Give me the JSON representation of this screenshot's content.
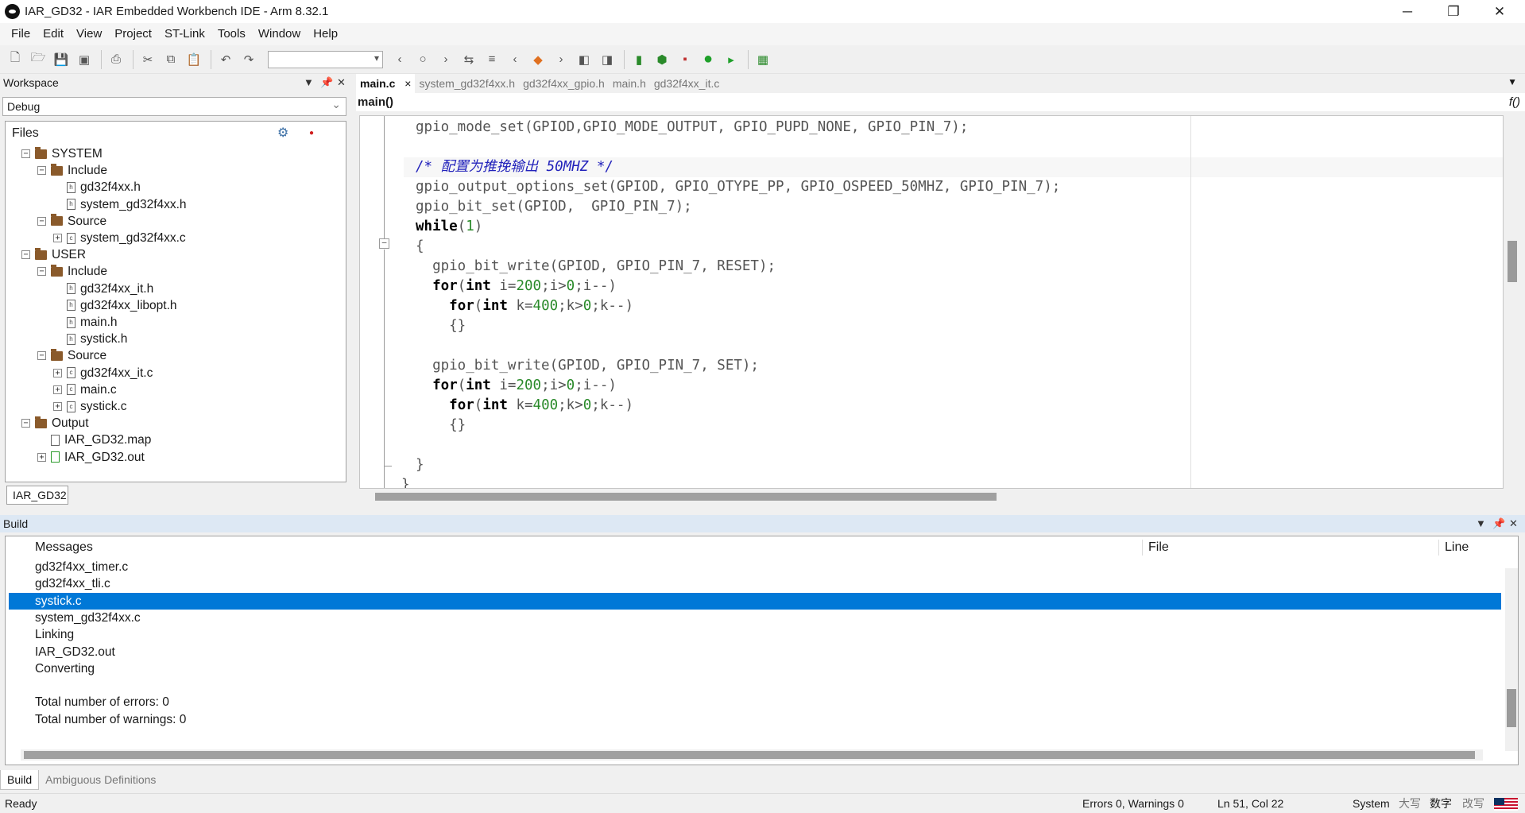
{
  "window": {
    "title": "IAR_GD32 - IAR Embedded Workbench IDE - Arm 8.32.1",
    "minimize": "─",
    "maximize": "❐",
    "close": "✕"
  },
  "menu": [
    "File",
    "Edit",
    "View",
    "Project",
    "ST-Link",
    "Tools",
    "Window",
    "Help"
  ],
  "workspace": {
    "title": "Workspace",
    "config": "Debug",
    "files_header": "Files",
    "tab": "IAR_GD32",
    "tree": [
      {
        "label": "SYSTEM",
        "kind": "folder",
        "exp": "−"
      },
      {
        "label": "Include",
        "kind": "folder",
        "exp": "−"
      },
      {
        "label": "gd32f4xx.h",
        "kind": "h"
      },
      {
        "label": "system_gd32f4xx.h",
        "kind": "h"
      },
      {
        "label": "Source",
        "kind": "folder",
        "exp": "−"
      },
      {
        "label": "system_gd32f4xx.c",
        "kind": "c",
        "exp": "+"
      },
      {
        "label": "USER",
        "kind": "folder",
        "exp": "−"
      },
      {
        "label": "Include",
        "kind": "folder",
        "exp": "−"
      },
      {
        "label": "gd32f4xx_it.h",
        "kind": "h"
      },
      {
        "label": "gd32f4xx_libopt.h",
        "kind": "h"
      },
      {
        "label": "main.h",
        "kind": "h"
      },
      {
        "label": "systick.h",
        "kind": "h"
      },
      {
        "label": "Source",
        "kind": "folder",
        "exp": "−"
      },
      {
        "label": "gd32f4xx_it.c",
        "kind": "c",
        "exp": "+"
      },
      {
        "label": "main.c",
        "kind": "c",
        "exp": "+"
      },
      {
        "label": "systick.c",
        "kind": "c",
        "exp": "+"
      },
      {
        "label": "Output",
        "kind": "folder",
        "exp": "−"
      },
      {
        "label": "IAR_GD32.map",
        "kind": "map"
      },
      {
        "label": "IAR_GD32.out",
        "kind": "out",
        "exp": "+"
      }
    ]
  },
  "editor": {
    "tabs": [
      "main.c",
      "system_gd32f4xx.h",
      "gd32f4xx_gpio.h",
      "main.h",
      "gd32f4xx_it.c"
    ],
    "tab_close": "×",
    "function": "main()",
    "func_icon": "f()",
    "code": [
      "gpio_mode_set(GPIOD,GPIO_MODE_OUTPUT, GPIO_PUPD_NONE, GPIO_PIN_7);",
      "",
      "/* 配置为推挽输出 50MHZ */",
      "gpio_output_options_set(GPIOD, GPIO_OTYPE_PP, GPIO_OSPEED_50MHZ, GPIO_PIN_7);",
      "gpio_bit_set(GPIOD,  GPIO_PIN_7);",
      "while(1)",
      "{",
      "  gpio_bit_write(GPIOD, GPIO_PIN_7, RESET);",
      "  for(int i=200;i>0;i--)",
      "    for(int k=400;k>0;k--)",
      "    {}",
      "",
      "  gpio_bit_write(GPIOD, GPIO_PIN_7, SET);",
      "  for(int i=200;i>0;i--)",
      "    for(int k=400;k>0;k--)",
      "    {}",
      "",
      "}",
      "}"
    ]
  },
  "build": {
    "title": "Build",
    "col_messages": "Messages",
    "col_file": "File",
    "col_line": "Line",
    "messages": [
      "gd32f4xx_timer.c",
      "gd32f4xx_tli.c",
      "systick.c",
      "system_gd32f4xx.c",
      "Linking",
      "IAR_GD32.out",
      "Converting",
      "",
      "Total number of errors: 0",
      "Total number of warnings: 0"
    ],
    "selected_index": 2,
    "tabs": [
      "Build",
      "Ambiguous Definitions"
    ]
  },
  "status": {
    "ready": "Ready",
    "errors": "Errors 0, Warnings 0",
    "position": "Ln 51, Col 22",
    "system": "System",
    "caps": "大写",
    "num": "数字",
    "ovr": "改写"
  },
  "colors": {
    "accent": "#0078d7",
    "keyword": "#000000",
    "number": "#2a8a2a",
    "comment": "#2222bb"
  }
}
